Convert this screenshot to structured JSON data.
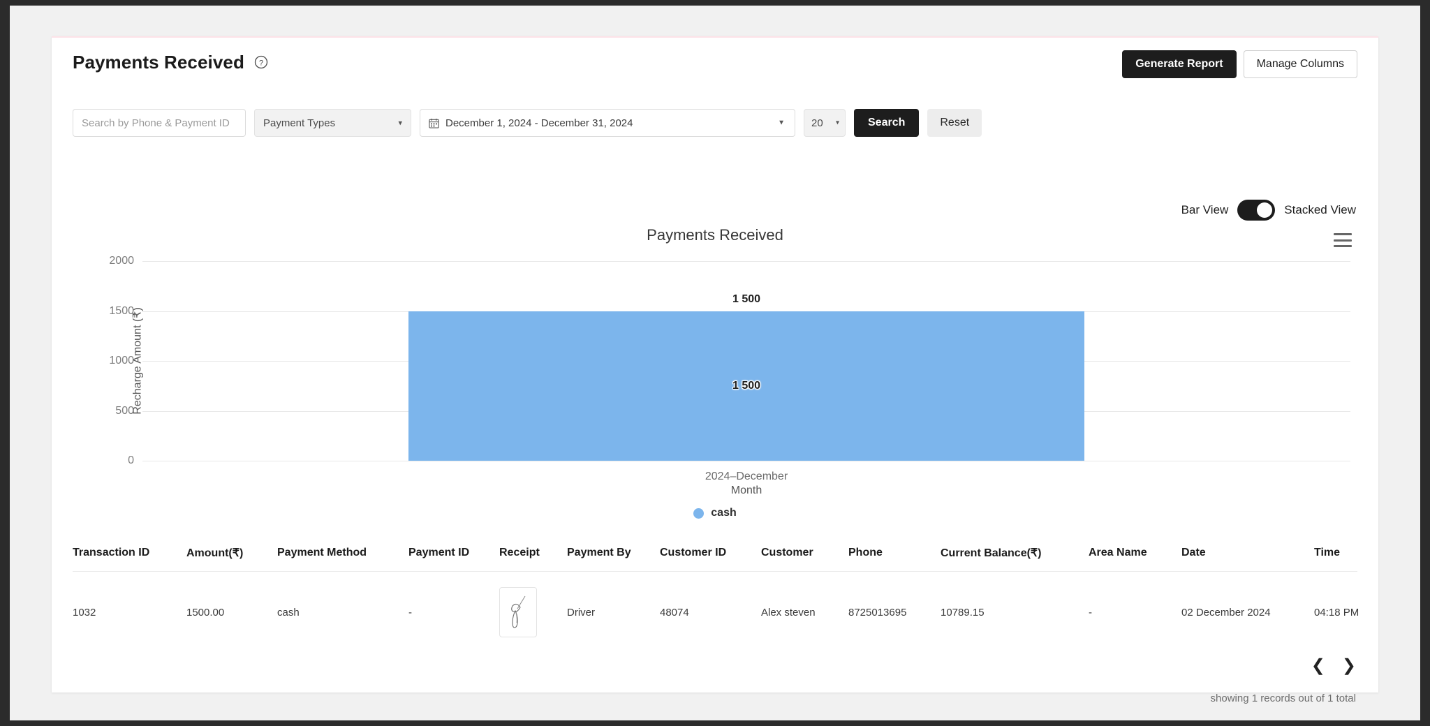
{
  "header": {
    "title": "Payments Received",
    "help_icon": "question-circle-icon",
    "generate_report_label": "Generate Report",
    "manage_columns_label": "Manage Columns"
  },
  "filters": {
    "search_placeholder": "Search by Phone & Payment ID",
    "search_value": "",
    "payment_types_label": "Payment Types",
    "date_range": "December 1, 2024 - December 31, 2024",
    "page_size": "20",
    "search_button": "Search",
    "reset_button": "Reset"
  },
  "view_toggle": {
    "left_label": "Bar View",
    "right_label": "Stacked View",
    "active": "Stacked View"
  },
  "chart_data": {
    "type": "bar",
    "title": "Payments Received",
    "categories": [
      "2024–December"
    ],
    "series": [
      {
        "name": "cash",
        "values": [
          1500
        ],
        "color": "#7cb5ec"
      }
    ],
    "point_labels": [
      "1 500"
    ],
    "total_labels": [
      "1 500"
    ],
    "xlabel": "Month",
    "ylabel": "Recharge Amount (₹)",
    "yticks": [
      "0",
      "500",
      "1000",
      "1500",
      "2000"
    ],
    "ylim": [
      0,
      2000
    ],
    "grid": true,
    "legend_position": "bottom",
    "menu_icon": "hamburger-menu-icon"
  },
  "table": {
    "columns": [
      "Transaction ID",
      "Amount(₹)",
      "Payment Method",
      "Payment ID",
      "Receipt",
      "Payment By",
      "Customer ID",
      "Customer",
      "Phone",
      "Current Balance(₹)",
      "Area Name",
      "Date",
      "Time"
    ],
    "rows": [
      {
        "transaction_id": "1032",
        "amount": "1500.00",
        "payment_method": "cash",
        "payment_id": "-",
        "receipt": "signature-thumbnail",
        "payment_by": "Driver",
        "customer_id": "48074",
        "customer": "Alex steven",
        "phone": "8725013695",
        "current_balance": "10789.15",
        "area_name": "-",
        "date": "02 December 2024",
        "time": "04:18 PM"
      }
    ]
  },
  "pager": {
    "prev_icon": "chevron-left-icon",
    "next_icon": "chevron-right-icon",
    "records_text": "showing 1 records out of 1 total"
  }
}
